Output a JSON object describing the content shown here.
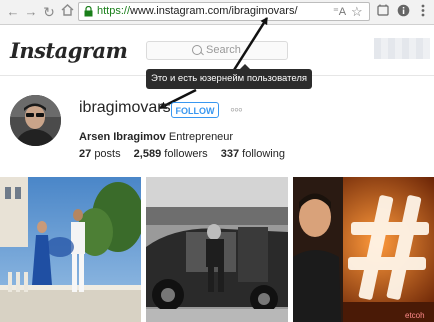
{
  "browser": {
    "url_scheme": "https://",
    "url_rest": "www.instagram.com/ibragimovars/",
    "reader_icon": "ᴬ",
    "star_icon": "☆"
  },
  "header": {
    "logo": "Instagram",
    "search_placeholder": "Search"
  },
  "tooltip": {
    "text": "Это и есть юзернейм пользователя"
  },
  "profile": {
    "username": "ibragimovars",
    "follow_label": "FOLLOW",
    "more_label": "○○○",
    "full_name": "Arsen Ibragimov",
    "bio": "Entrepreneur",
    "stats": [
      {
        "value": "27",
        "label": "posts"
      },
      {
        "value": "2,589",
        "label": "followers"
      },
      {
        "value": "337",
        "label": "following"
      }
    ]
  },
  "colors": {
    "accent": "#3897f0",
    "secure_green": "#1a7f1a",
    "tooltip_bg": "#2c2c2c"
  },
  "photos": {
    "watermark": "etcoh"
  }
}
